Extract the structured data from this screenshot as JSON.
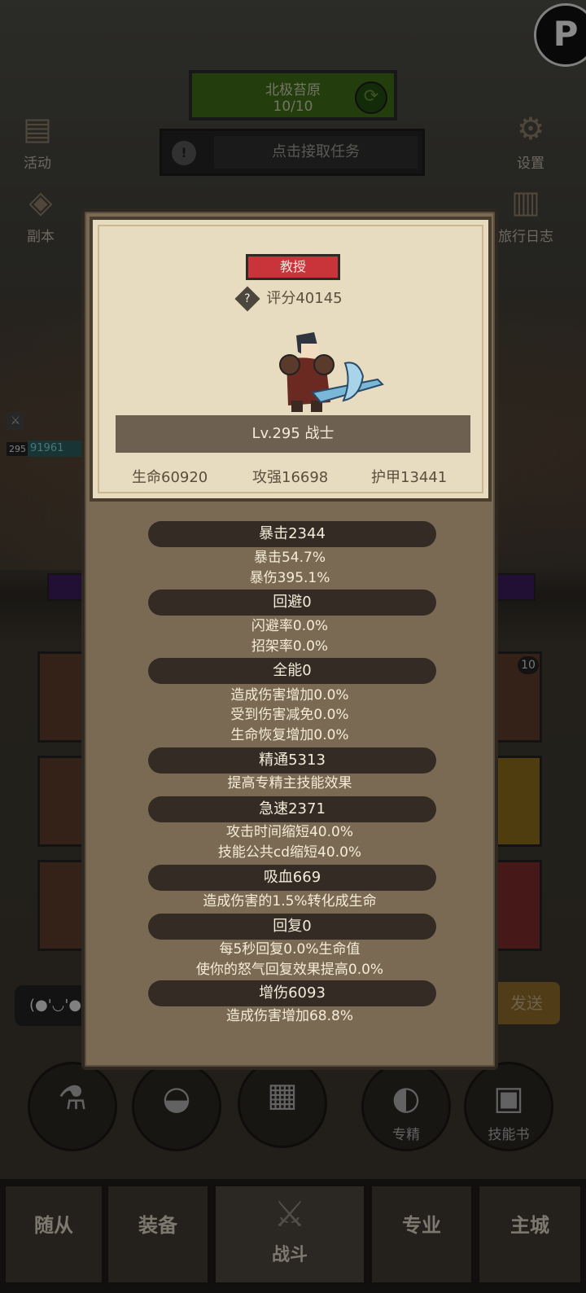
{
  "hud": {
    "map_name": "北极苔原",
    "map_progress": "10/10",
    "task_text": "点击接取任务",
    "left_icons": [
      "活动",
      "副本"
    ],
    "right_icons": [
      "设置",
      "旅行日志"
    ],
    "player_level": "295",
    "player_hp": "91961"
  },
  "background": {
    "badge": "10",
    "chat_text": "(●'◡'●",
    "send_label": "发送",
    "round_buttons": [
      "",
      "",
      "",
      "专精",
      "技能书"
    ]
  },
  "nav": {
    "tabs": [
      "随从",
      "装备",
      "战斗",
      "专业",
      "主城"
    ]
  },
  "modal": {
    "rank": "教授",
    "score": "评分40145",
    "class_line": "Lv.295 战士",
    "hp": "生命60920",
    "attack": "攻强16698",
    "armor": "护甲13441",
    "sections": [
      {
        "title": "暴击2344",
        "lines": [
          "暴击54.7%",
          "暴伤395.1%"
        ]
      },
      {
        "title": "回避0",
        "lines": [
          "闪避率0.0%",
          "招架率0.0%"
        ]
      },
      {
        "title": "全能0",
        "lines": [
          "造成伤害增加0.0%",
          "受到伤害减免0.0%",
          "生命恢复增加0.0%"
        ]
      },
      {
        "title": "精通5313",
        "lines": [
          "提高专精主技能效果"
        ]
      },
      {
        "title": "急速2371",
        "lines": [
          "攻击时间缩短40.0%",
          "技能公共cd缩短40.0%"
        ]
      },
      {
        "title": "吸血669",
        "lines": [
          "造成伤害的1.5%转化成生命"
        ]
      },
      {
        "title": "回复0",
        "lines": [
          "每5秒回复0.0%生命值",
          "使你的怒气回复效果提高0.0%"
        ]
      },
      {
        "title": "增伤6093",
        "lines": [
          "造成伤害增加68.8%"
        ]
      }
    ]
  }
}
